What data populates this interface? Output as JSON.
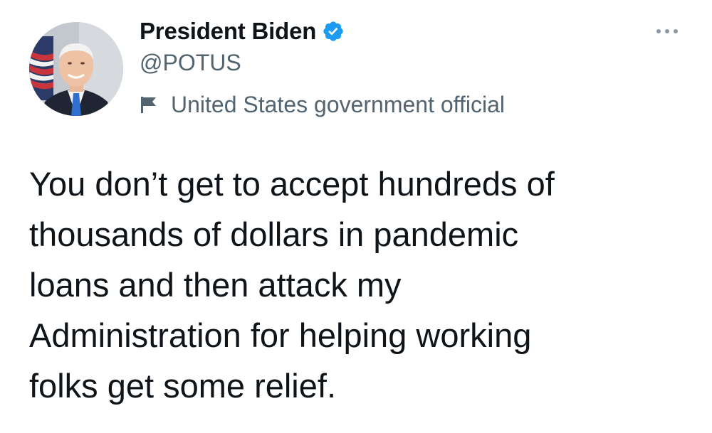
{
  "author": {
    "display_name": "President Biden",
    "handle": "@POTUS",
    "verified": true,
    "label": "United States government official",
    "avatar_icon": "profile-photo",
    "verified_icon": "verified-badge-icon",
    "label_icon": "flag-icon"
  },
  "more_menu": {
    "icon": "more-options-icon"
  },
  "tweet": {
    "lines": [
      "You don’t get to accept hundreds of",
      "thousands of dollars in pandemic",
      "loans and then attack my",
      "Administration for helping working",
      "folks get some relief."
    ]
  },
  "colors": {
    "verified_blue": "#1d9bf0",
    "secondary_text": "#536471",
    "primary_text": "#0f1419"
  }
}
